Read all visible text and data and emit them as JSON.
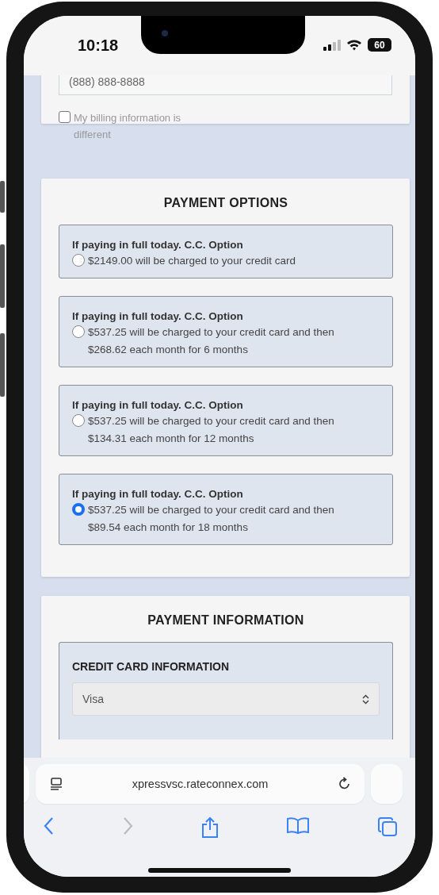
{
  "status_bar": {
    "time": "10:18",
    "battery": "60"
  },
  "billing_card": {
    "phone_field": {
      "value": "(888) 888-8888"
    },
    "billing_different": {
      "label": "My billing information is different",
      "checked": false
    }
  },
  "payment_options": {
    "title": "PAYMENT OPTIONS",
    "options": [
      {
        "heading": "If paying in full today. C.C. Option",
        "text": "$2149.00 will be charged to your credit card",
        "selected": false
      },
      {
        "heading": "If paying in full today. C.C. Option",
        "text": "$537.25 will be charged to your credit card and then $268.62 each month for 6 months",
        "selected": false
      },
      {
        "heading": "If paying in full today. C.C. Option",
        "text": "$537.25 will be charged to your credit card and then $134.31 each month for 12 months",
        "selected": false
      },
      {
        "heading": "If paying in full today. C.C. Option",
        "text": "$537.25 will be charged to your credit card and then $89.54 each month for 18 months",
        "selected": true
      }
    ]
  },
  "payment_information": {
    "title": "PAYMENT INFORMATION",
    "section_title": "CREDIT CARD INFORMATION",
    "card_type": {
      "value": "Visa"
    }
  },
  "browser": {
    "url": "xpressvsc.rateconnex.com",
    "forward_disabled": true
  }
}
